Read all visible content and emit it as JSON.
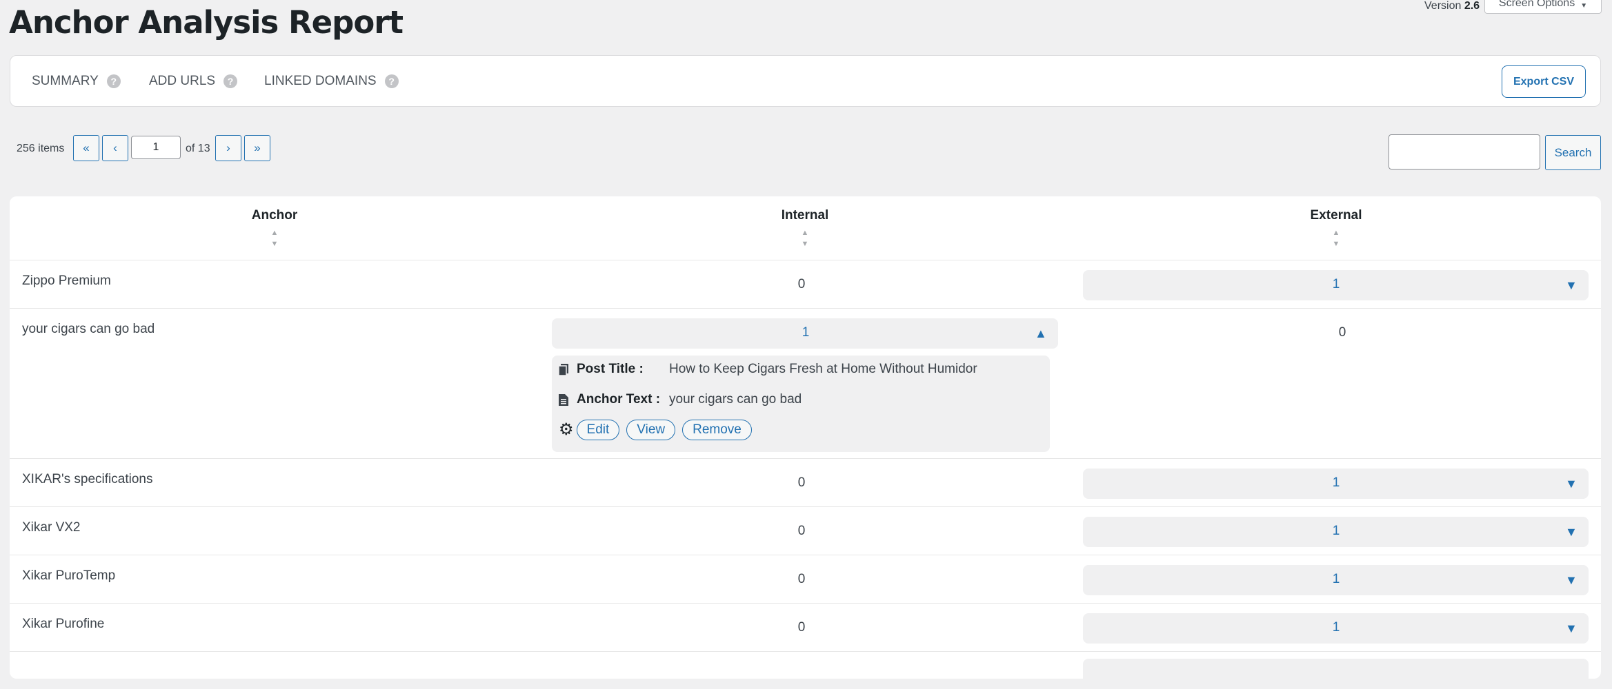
{
  "header": {
    "title": "Anchor Analysis Report",
    "version_label": "Version",
    "version_number": "2.6",
    "screen_options": "Screen Options"
  },
  "tabs": [
    {
      "label": "SUMMARY"
    },
    {
      "label": "ADD URLS"
    },
    {
      "label": "LINKED DOMAINS"
    }
  ],
  "help_glyph": "?",
  "export_label": "Export CSV",
  "pagination": {
    "items_count": "256 items",
    "first": "«",
    "prev": "‹",
    "current_page": "1",
    "of_total": "of 13",
    "next": "›",
    "last": "»"
  },
  "search": {
    "button_label": "Search",
    "value": ""
  },
  "table": {
    "columns": [
      "Anchor",
      "Internal",
      "External"
    ],
    "rows": [
      {
        "anchor": "Zippo Premium",
        "internal": "0",
        "external": "1"
      },
      {
        "anchor": "your cigars can go bad",
        "internal": "1",
        "external": "0"
      },
      {
        "anchor": "XIKAR's specifications",
        "internal": "0",
        "external": "1"
      },
      {
        "anchor": "Xikar VX2",
        "internal": "0",
        "external": "1"
      },
      {
        "anchor": "Xikar PuroTemp",
        "internal": "0",
        "external": "1"
      },
      {
        "anchor": "Xikar Purofine",
        "internal": "0",
        "external": "1"
      }
    ]
  },
  "detail": {
    "post_title_label": "Post Title :",
    "post_title_value": "How to Keep Cigars Fresh at Home Without Humidor",
    "anchor_text_label": "Anchor Text :",
    "anchor_text_value": "your cigars can go bad",
    "edit_label": "Edit",
    "view_label": "View",
    "remove_label": "Remove"
  },
  "icons": {
    "sort_up": "▲",
    "sort_down": "▼",
    "caret_down": "▼",
    "caret_up": "▲",
    "gear": "⚙"
  },
  "colors": {
    "accent": "#2271b1",
    "background": "#f0f0f1"
  }
}
